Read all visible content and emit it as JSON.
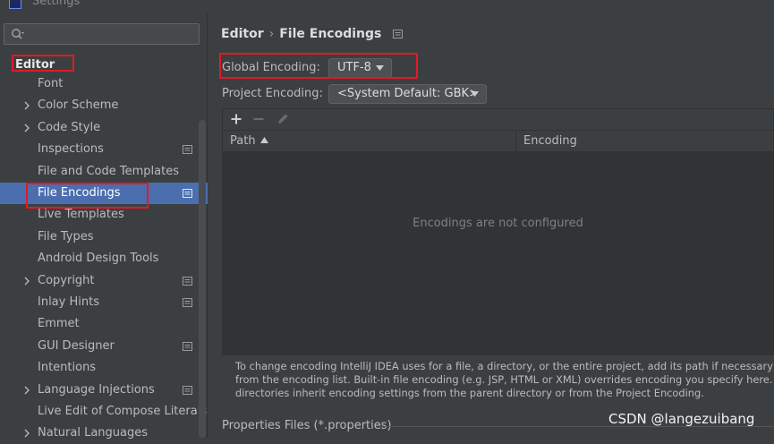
{
  "window": {
    "title": "Settings"
  },
  "sidebar": {
    "search_placeholder": "",
    "root_label": "Editor",
    "items": [
      {
        "label": "Font",
        "expandable": false,
        "project": false,
        "selected": false
      },
      {
        "label": "Color Scheme",
        "expandable": true,
        "project": false,
        "selected": false
      },
      {
        "label": "Code Style",
        "expandable": true,
        "project": false,
        "selected": false
      },
      {
        "label": "Inspections",
        "expandable": false,
        "project": true,
        "selected": false
      },
      {
        "label": "File and Code Templates",
        "expandable": false,
        "project": false,
        "selected": false
      },
      {
        "label": "File Encodings",
        "expandable": false,
        "project": true,
        "selected": true
      },
      {
        "label": "Live Templates",
        "expandable": false,
        "project": false,
        "selected": false
      },
      {
        "label": "File Types",
        "expandable": false,
        "project": false,
        "selected": false
      },
      {
        "label": "Android Design Tools",
        "expandable": false,
        "project": false,
        "selected": false
      },
      {
        "label": "Copyright",
        "expandable": true,
        "project": true,
        "selected": false
      },
      {
        "label": "Inlay Hints",
        "expandable": false,
        "project": true,
        "selected": false
      },
      {
        "label": "Emmet",
        "expandable": false,
        "project": false,
        "selected": false
      },
      {
        "label": "GUI Designer",
        "expandable": false,
        "project": true,
        "selected": false
      },
      {
        "label": "Intentions",
        "expandable": false,
        "project": false,
        "selected": false
      },
      {
        "label": "Language Injections",
        "expandable": true,
        "project": true,
        "selected": false
      },
      {
        "label": "Live Edit of Compose Literals",
        "expandable": false,
        "project": false,
        "selected": false
      },
      {
        "label": "Natural Languages",
        "expandable": true,
        "project": false,
        "selected": false
      }
    ]
  },
  "main": {
    "breadcrumb": {
      "parent": "Editor",
      "separator": "›",
      "current": "File Encodings"
    },
    "global_encoding": {
      "label": "Global Encoding:",
      "value": "UTF-8"
    },
    "project_encoding": {
      "label": "Project Encoding:",
      "value": "<System Default: GBK>"
    },
    "toolbar": {
      "add_icon": "plus-icon",
      "remove_icon": "minus-icon",
      "edit_icon": "pencil-icon"
    },
    "table": {
      "columns": [
        "Path",
        "Encoding"
      ],
      "empty_text": "Encodings are not configured"
    },
    "help_lines": [
      "To change encoding IntelliJ IDEA uses for a file, a directory, or the entire project, add its path if necessary and then",
      "from the encoding list. Built-in file encoding (e.g. JSP, HTML or XML) overrides encoding you specify here. If not s",
      "directories inherit encoding settings from the parent directory or from the Project Encoding."
    ],
    "properties_files_label": "Properties Files (*.properties)"
  },
  "watermark": "CSDN @langezuibang",
  "colors": {
    "background": "#3c3f41",
    "selection": "#4b6eaf",
    "annotation_red": "#e01b24"
  }
}
